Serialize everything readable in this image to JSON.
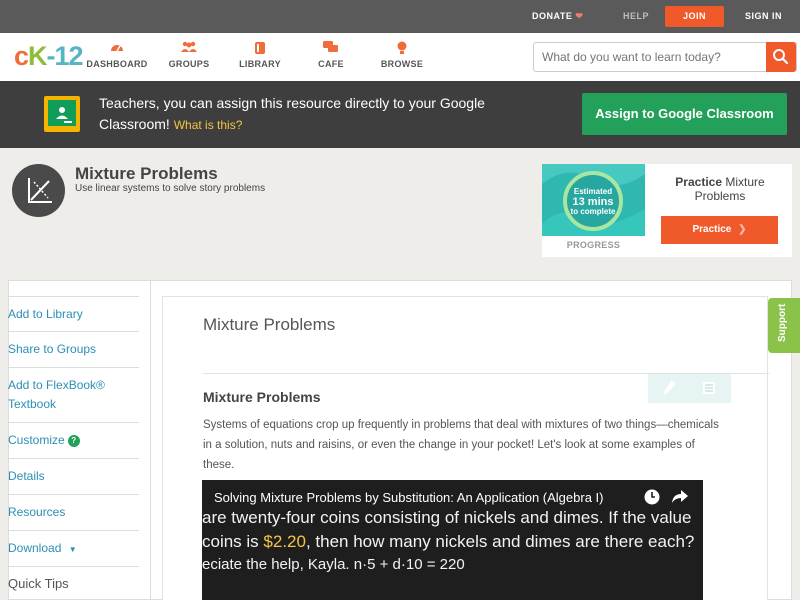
{
  "topbar": {
    "donate": "DONATE",
    "help": "HELP",
    "join": "JOIN",
    "sign_in": "SIGN IN"
  },
  "nav": {
    "logo": [
      "c",
      "K",
      "-12"
    ],
    "items": [
      {
        "label": "DASHBOARD",
        "icon": "dashboard-icon"
      },
      {
        "label": "GROUPS",
        "icon": "groups-icon"
      },
      {
        "label": "LIBRARY",
        "icon": "library-icon"
      },
      {
        "label": "CAFE",
        "icon": "cafe-icon"
      },
      {
        "label": "BROWSE",
        "icon": "browse-icon"
      }
    ],
    "search_placeholder": "What do you want to learn today?"
  },
  "banner": {
    "text": "Teachers, you can assign this resource directly to your Google Classroom!",
    "what_link": "What is this?",
    "assign_button": "Assign to Google Classroom"
  },
  "concept": {
    "title": "Mixture Problems",
    "subtitle": "Use linear systems to solve story problems"
  },
  "practice": {
    "estimated": "Estimated",
    "mins": "13 mins",
    "to_complete": "to complete",
    "progress_label": "PROGRESS",
    "title_bold": "Practice",
    "title_rest": "Mixture Problems",
    "button": "Practice"
  },
  "sidebar": {
    "items": [
      "Add to Library",
      "Share to Groups",
      "Add to FlexBook® Textbook",
      "Customize",
      "Details",
      "Resources",
      "Download",
      "Quick Tips"
    ]
  },
  "article": {
    "title": "Mixture Problems",
    "heading": "Mixture Problems",
    "body": "Systems of equations crop up frequently in problems that deal with mixtures of two things—chemicals in a solution, nuts and raisins, or even the change in your pocket! Let's look at some examples of these."
  },
  "video": {
    "title": "Solving Mixture Problems by Substitution: An Application (Algebra I)",
    "line1": " are twenty-four coins consisting of nickels and dimes.  If the value",
    "line2a": " coins is ",
    "line2b": "$2.20",
    "line2c": ", then how many nickels and dimes are there each?",
    "line3": "eciate the help, Kayla.      n·5 + d·10 = 220"
  },
  "support": "Support",
  "colors": {
    "accent": "#f05a2b",
    "green": "#23a05a",
    "link": "#2b8fb4"
  }
}
